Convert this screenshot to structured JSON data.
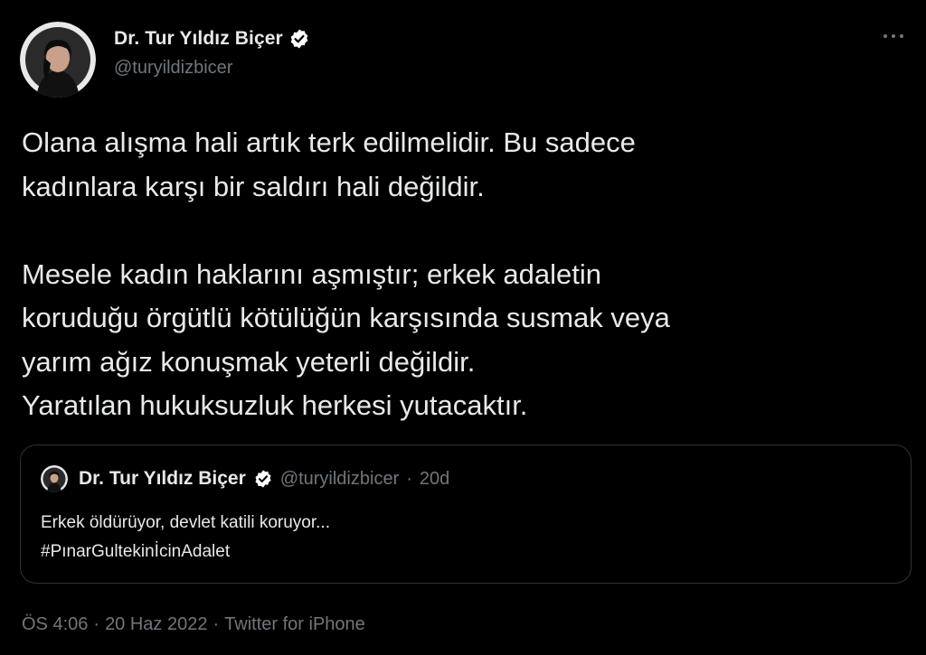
{
  "author": {
    "display_name": "Dr. Tur Yıldız Biçer",
    "handle": "@turyildizbicer",
    "verified_icon": "verified-badge-icon",
    "avatar_icon": "profile-avatar"
  },
  "tweet": {
    "paragraph1": [
      "Olana alışma hali artık terk edilmelidir. Bu sadece",
      "kadınlara karşı bir saldırı hali değildir."
    ],
    "paragraph2": [
      "Mesele kadın haklarını aşmıştır; erkek adaletin",
      "koruduğu örgütlü kötülüğün karşısında susmak veya",
      "yarım ağız konuşmak yeterli değildir.",
      "Yaratılan hukuksuzluk herkesi yutacaktır."
    ]
  },
  "quoted": {
    "display_name": "Dr. Tur Yıldız Biçer",
    "handle": "@turyildizbicer",
    "separator": "·",
    "time": "20d",
    "lines": [
      "Erkek öldürüyor, devlet katili koruyor...",
      "#PınarGultekinİcinAdalet"
    ]
  },
  "footer": {
    "time": "ÖS 4:06",
    "sep1": "·",
    "date": "20 Haz 2022",
    "sep2": "·",
    "source": "Twitter for iPhone"
  },
  "colors": {
    "background": "#000000",
    "text": "#e7e9ea",
    "muted": "#71767b",
    "border": "#2f3336",
    "verified": "#ffffff"
  }
}
